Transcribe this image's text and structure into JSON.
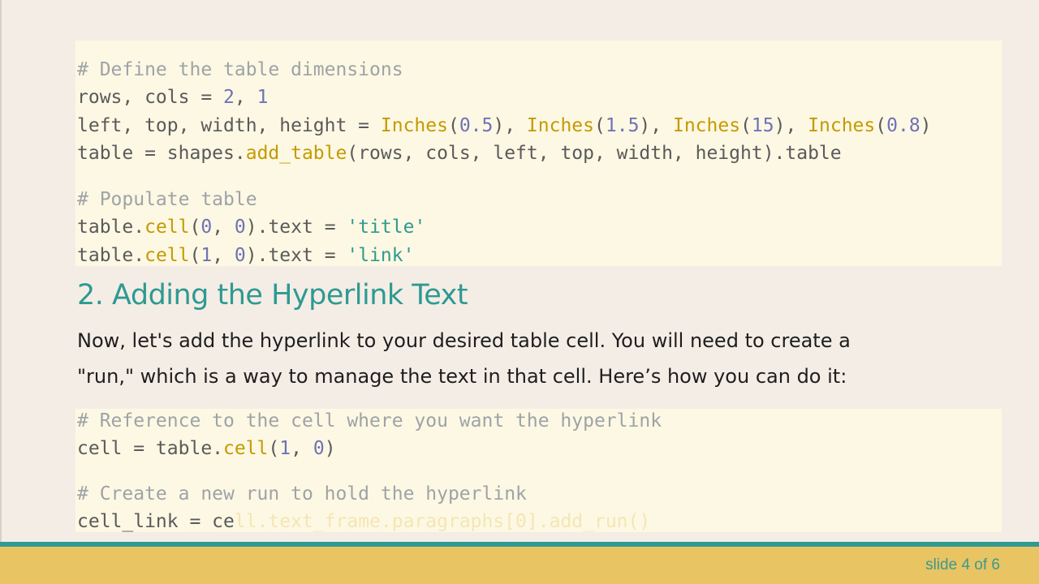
{
  "code_block_1": {
    "lines": [
      [
        {
          "t": "# Define the table dimensions",
          "c": "comment"
        }
      ],
      [
        {
          "t": "rows, cols = ",
          "c": "plain"
        },
        {
          "t": "2",
          "c": "num"
        },
        {
          "t": ", ",
          "c": "plain"
        },
        {
          "t": "1",
          "c": "num"
        }
      ],
      [
        {
          "t": "left, top, width, height = ",
          "c": "plain"
        },
        {
          "t": "Inches",
          "c": "func"
        },
        {
          "t": "(",
          "c": "plain"
        },
        {
          "t": "0.5",
          "c": "num"
        },
        {
          "t": "), ",
          "c": "plain"
        },
        {
          "t": "Inches",
          "c": "func"
        },
        {
          "t": "(",
          "c": "plain"
        },
        {
          "t": "1.5",
          "c": "num"
        },
        {
          "t": "), ",
          "c": "plain"
        },
        {
          "t": "Inches",
          "c": "func"
        },
        {
          "t": "(",
          "c": "plain"
        },
        {
          "t": "15",
          "c": "num"
        },
        {
          "t": "), ",
          "c": "plain"
        },
        {
          "t": "Inches",
          "c": "func"
        },
        {
          "t": "(",
          "c": "plain"
        },
        {
          "t": "0.8",
          "c": "num"
        },
        {
          "t": ")",
          "c": "plain"
        }
      ],
      [
        {
          "t": "table = shapes.",
          "c": "plain"
        },
        {
          "t": "add_table",
          "c": "func"
        },
        {
          "t": "(rows, cols, left, top, width, height).table",
          "c": "plain"
        }
      ],
      [
        {
          "t": "# Populate table",
          "c": "comment"
        }
      ],
      [
        {
          "t": "table.",
          "c": "plain"
        },
        {
          "t": "cell",
          "c": "func"
        },
        {
          "t": "(",
          "c": "plain"
        },
        {
          "t": "0",
          "c": "num"
        },
        {
          "t": ", ",
          "c": "plain"
        },
        {
          "t": "0",
          "c": "num"
        },
        {
          "t": ").text = ",
          "c": "plain"
        },
        {
          "t": "'title'",
          "c": "str"
        }
      ],
      [
        {
          "t": "table.",
          "c": "plain"
        },
        {
          "t": "cell",
          "c": "func"
        },
        {
          "t": "(",
          "c": "plain"
        },
        {
          "t": "1",
          "c": "num"
        },
        {
          "t": ", ",
          "c": "plain"
        },
        {
          "t": "0",
          "c": "num"
        },
        {
          "t": ").text = ",
          "c": "plain"
        },
        {
          "t": "'link'",
          "c": "str"
        }
      ]
    ]
  },
  "heading": "2. Adding the Hyperlink Text",
  "paragraph": {
    "line1": "Now, let's add the hyperlink to your desired table cell. You will need to create a",
    "line2": "\"run,\" which is a way to manage the text in that cell. Here’s how you can do it:"
  },
  "code_block_2": {
    "lines": [
      [
        {
          "t": "# Reference to the cell where you want the hyperlink",
          "c": "comment"
        }
      ],
      [
        {
          "t": "cell = table.",
          "c": "plain"
        },
        {
          "t": "cell",
          "c": "func"
        },
        {
          "t": "(",
          "c": "plain"
        },
        {
          "t": "1",
          "c": "num"
        },
        {
          "t": ", ",
          "c": "plain"
        },
        {
          "t": "0",
          "c": "num"
        },
        {
          "t": ")",
          "c": "plain"
        }
      ],
      [
        {
          "t": "# Create a new run to hold the hyperlink",
          "c": "comment"
        }
      ],
      [
        {
          "t": "cell_link = ce",
          "c": "plain"
        },
        {
          "t": "ll.text_frame.paragraphs[0].add_run()",
          "c": "faded"
        }
      ]
    ]
  },
  "footer": {
    "slide_number": "slide 4 of 6"
  }
}
